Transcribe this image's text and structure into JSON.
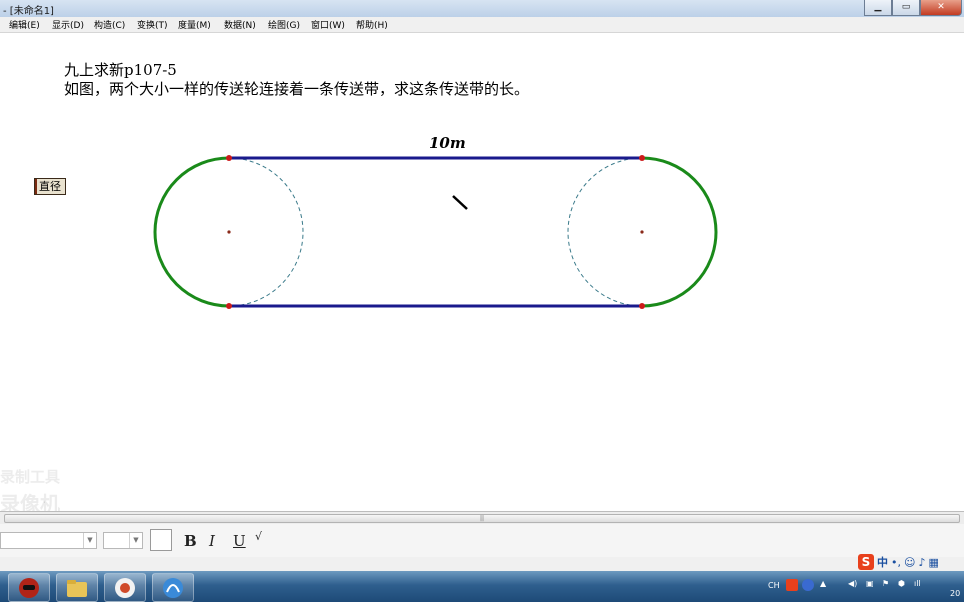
{
  "window": {
    "title": "- [未命名1]",
    "controls": [
      "minimize-icon",
      "maximize-icon",
      "close-icon"
    ]
  },
  "menu": [
    "编辑(E)",
    "显示(D)",
    "构造(C)",
    "变换(T)",
    "度量(M)",
    "数据(N)",
    "绘图(G)",
    "窗口(W)",
    "帮助(H)"
  ],
  "problem": {
    "line1": "九上求新p107-5",
    "line2": "如图，两个大小一样的传送轮连接着一条传送带，求这条传送带的长。"
  },
  "diameter_button": "直径",
  "figure": {
    "length_label": "10m",
    "arc_color": "#1a8a1a",
    "belt_color": "#1a1a8c",
    "point_color": "#cc1a1a",
    "guide_color": "#3a7a8a"
  },
  "watermark": {
    "line1": "录制工具",
    "line2": "录像机"
  },
  "text_toolbar": {
    "bold": "B",
    "italic": "I",
    "underline": "U",
    "fraction": "√"
  },
  "ime": {
    "brand": "S",
    "mode": "中"
  },
  "tray": {
    "lang": "CH",
    "clock": "20"
  }
}
